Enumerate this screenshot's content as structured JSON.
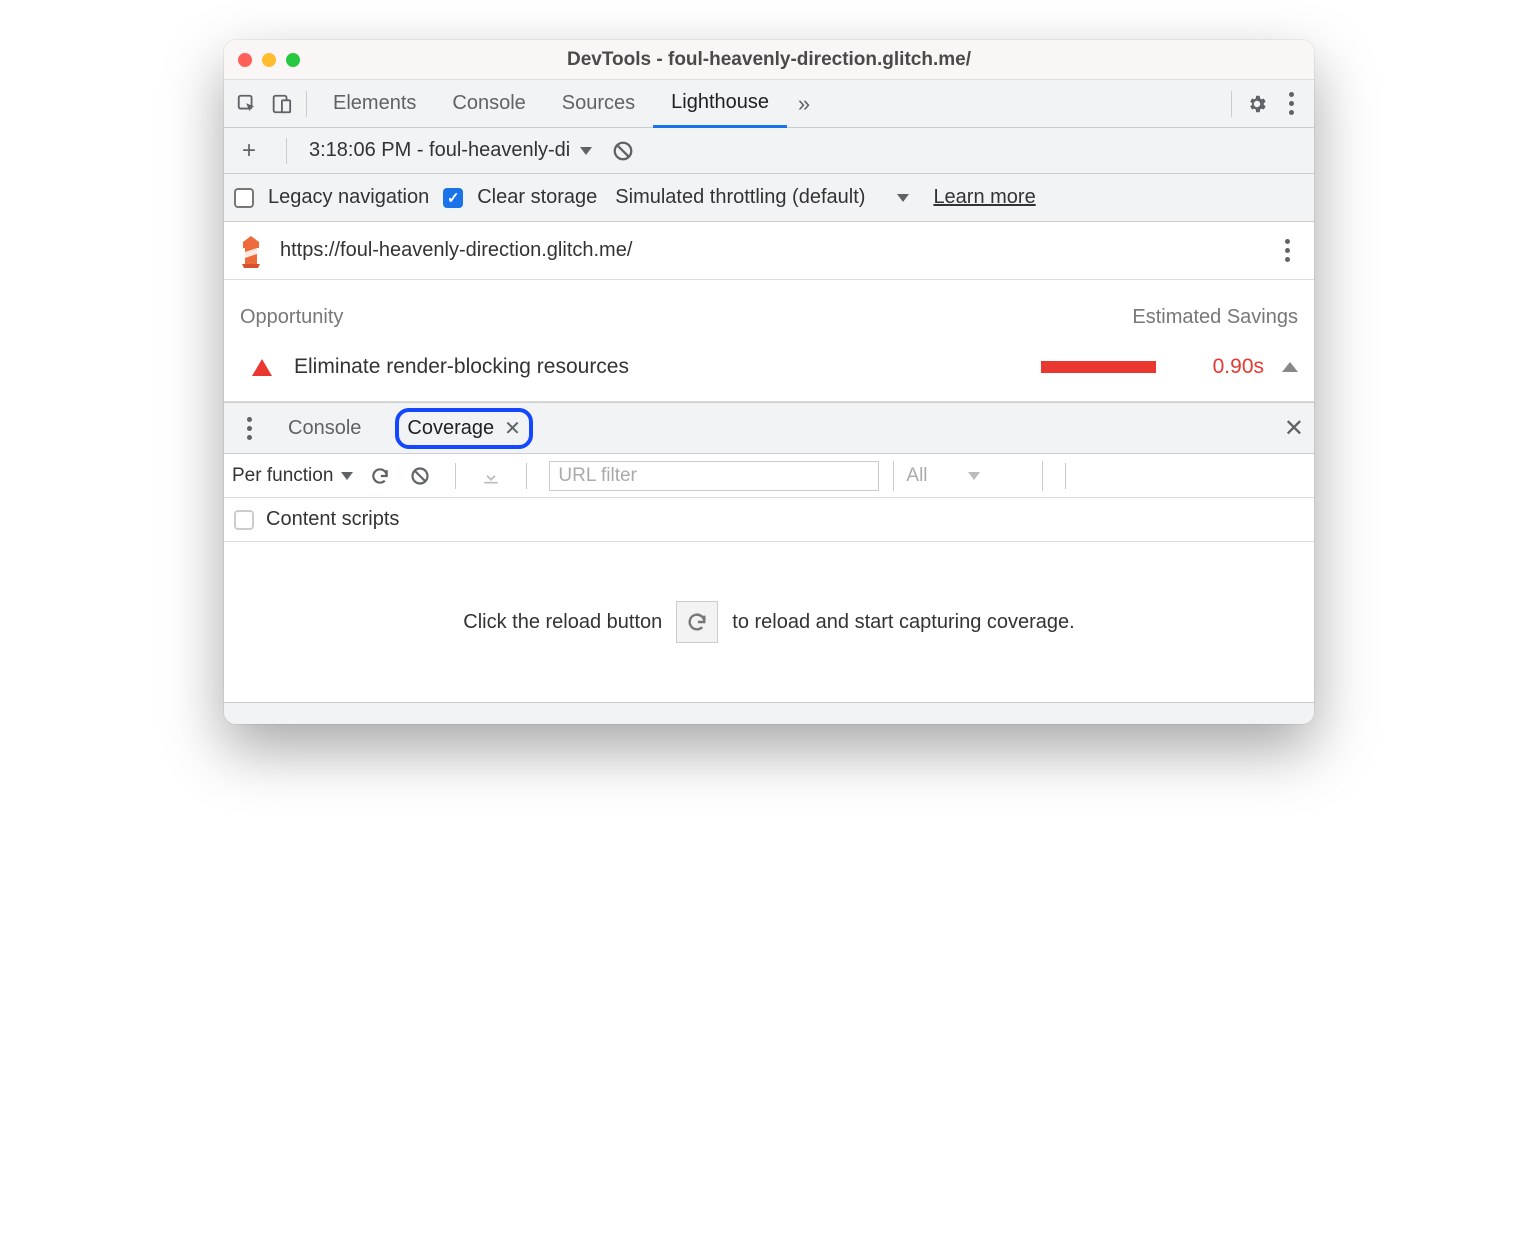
{
  "window": {
    "title": "DevTools - foul-heavenly-direction.glitch.me/"
  },
  "tabs": {
    "items": [
      "Elements",
      "Console",
      "Sources",
      "Lighthouse"
    ],
    "active": "Lighthouse"
  },
  "lighthouse_bar": {
    "report_label": "3:18:06 PM - foul-heavenly-di"
  },
  "settings": {
    "legacy_label": "Legacy navigation",
    "clear_label": "Clear storage",
    "throttling_label": "Simulated throttling (default)",
    "learn_more": "Learn more"
  },
  "report": {
    "url": "https://foul-heavenly-direction.glitch.me/",
    "opportunity_header": "Opportunity",
    "savings_header": "Estimated Savings",
    "item": {
      "title": "Eliminate render-blocking resources",
      "savings": "0.90s"
    }
  },
  "drawer": {
    "tabs": [
      "Console",
      "Coverage"
    ],
    "active": "Coverage"
  },
  "coverage": {
    "granularity": "Per function",
    "url_filter_placeholder": "URL filter",
    "type_filter": "All",
    "content_scripts_label": "Content scripts",
    "empty_prefix": "Click the reload button",
    "empty_suffix": "to reload and start capturing coverage."
  }
}
